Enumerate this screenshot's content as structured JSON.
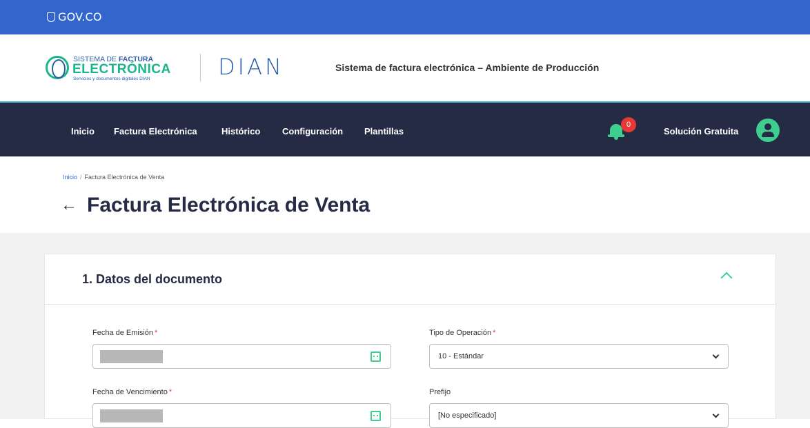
{
  "gov_bar": {
    "logo_text": "GOV.CO"
  },
  "brand": {
    "sfe_line1_prefix": "SISTEMA DE ",
    "sfe_line1_bold": "FACTURA",
    "sfe_line2": "ELECTRÓNICA",
    "sfe_line3": "Servicios y documentos digitales DIAN",
    "dian_logo": "DIAN",
    "tagline": "Sistema de factura electrónica – Ambiente de Producción"
  },
  "nav": {
    "items": [
      "Inicio",
      "Factura Electrónica",
      "Histórico",
      "Configuración",
      "Plantillas"
    ],
    "notification_count": "0",
    "user_label": "Solución Gratuita"
  },
  "breadcrumb": {
    "home": "Inicio",
    "separator": "/",
    "current": "Factura Electrónica de Venta"
  },
  "page": {
    "back_glyph": "←",
    "title": "Factura Electrónica de Venta"
  },
  "section": {
    "title": "1. Datos del documento",
    "fields": {
      "fecha_emision": {
        "label": "Fecha de Emisión",
        "required": "*"
      },
      "tipo_operacion": {
        "label": "Tipo de Operación",
        "required": "*",
        "value": "10 - Estándar"
      },
      "fecha_vencimiento": {
        "label": "Fecha de Vencimiento",
        "required": "*"
      },
      "prefijo": {
        "label": "Prefijo",
        "value": "[No especificado]"
      }
    }
  },
  "colors": {
    "gov_blue": "#3366cc",
    "nav_dark": "#262b45",
    "accent_green": "#3ecf8e",
    "badge_red": "#e53935"
  }
}
